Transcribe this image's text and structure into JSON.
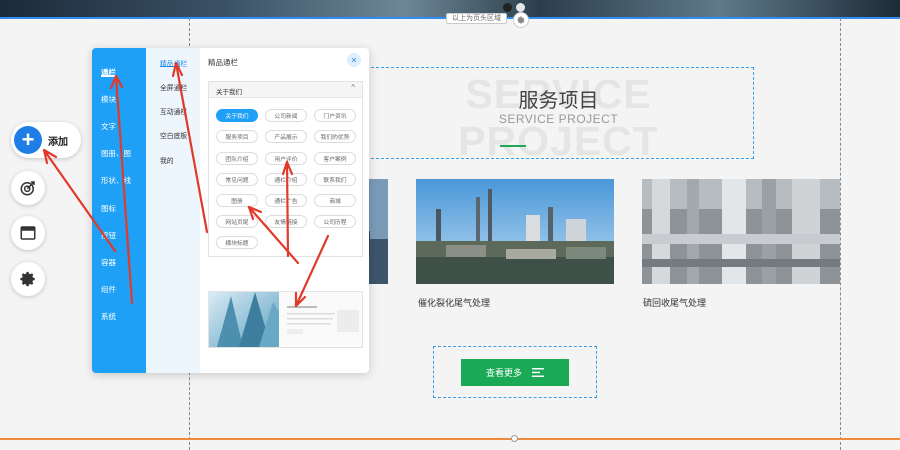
{
  "topbar": {
    "region_label": "以上为页头区域"
  },
  "add_tool": {
    "label": "添加"
  },
  "panel": {
    "categories": [
      "通栏",
      "模块",
      "文字",
      "图册、图",
      "形状、线",
      "图标",
      "按钮",
      "容器",
      "组件",
      "系统"
    ],
    "subcategories": [
      "精品通栏",
      "全屏通栏",
      "互动通栏",
      "空白底板",
      "我的"
    ],
    "title": "精品通栏",
    "close_glyph": "×",
    "group": {
      "title": "关于我们",
      "caret": "^",
      "tags": [
        "关于我们",
        "公司新闻",
        "门户资讯",
        "服务项目",
        "产品展示",
        "我们的优势",
        "团队介绍",
        "用户评价",
        "客户案例",
        "常见问题",
        "通栏介绍",
        "联系我们",
        "图册",
        "通栏广告",
        "商城",
        "网站页尾",
        "友情链接",
        "公司历程",
        "横块标题"
      ]
    }
  },
  "section": {
    "ghost_text": "SERVICE PROJECT",
    "title": "服务项目",
    "subtitle": "SERVICE PROJECT"
  },
  "cards": [
    {
      "caption": "催化裂化尾气处理"
    },
    {
      "caption": "硫回收尾气处理"
    }
  ],
  "more_button": {
    "label": "查看更多"
  },
  "colors": {
    "accent_blue": "#1da0f5",
    "brand_green": "#1aaa55",
    "annotation_red": "#e23a2a"
  }
}
